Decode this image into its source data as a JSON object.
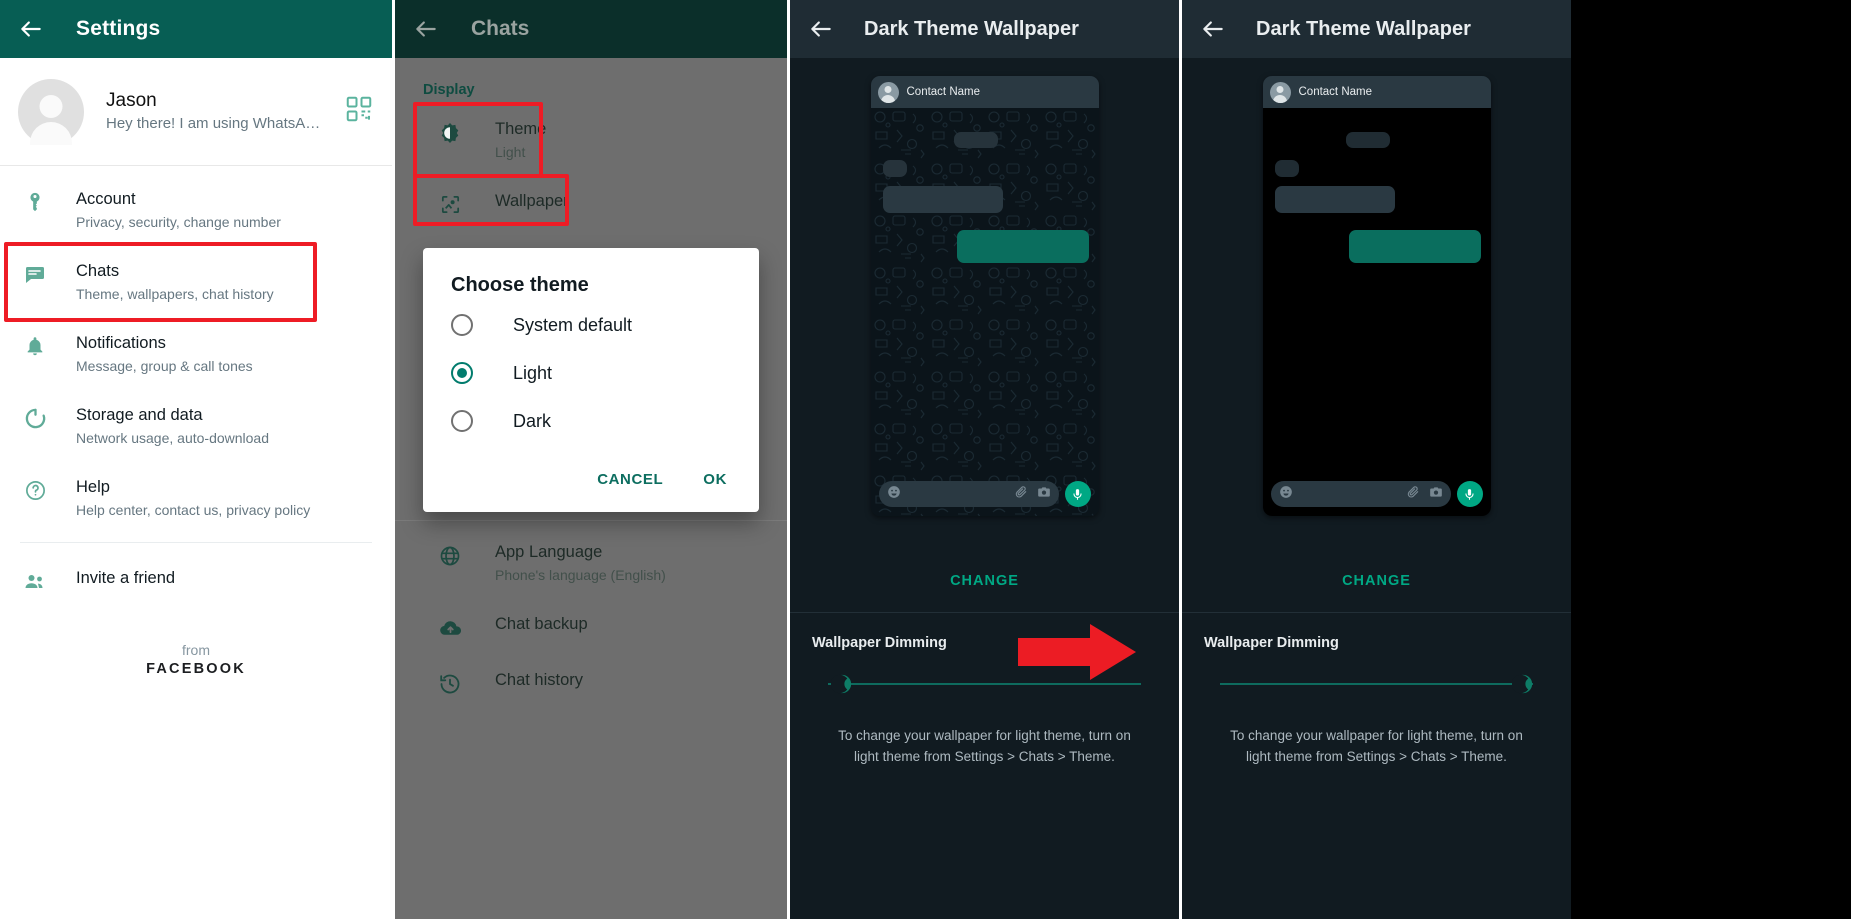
{
  "panel1": {
    "appbar": {
      "title": "Settings",
      "back_icon": "arrow-left-icon"
    },
    "profile": {
      "name": "Jason",
      "status": "Hey there! I am using WhatsA…",
      "qr_icon": "qr-code-icon",
      "avatar_icon": "default-avatar-icon"
    },
    "items": [
      {
        "icon": "key-icon",
        "title": "Account",
        "subtitle": "Privacy, security, change number",
        "highlighted": false
      },
      {
        "icon": "chat-bubble-icon",
        "title": "Chats",
        "subtitle": "Theme, wallpapers, chat history",
        "highlighted": true
      },
      {
        "icon": "bell-icon",
        "title": "Notifications",
        "subtitle": "Message, group & call tones",
        "highlighted": false
      },
      {
        "icon": "data-usage-icon",
        "title": "Storage and data",
        "subtitle": "Network usage, auto-download",
        "highlighted": false
      },
      {
        "icon": "help-circle-icon",
        "title": "Help",
        "subtitle": "Help center, contact us, privacy policy",
        "highlighted": false
      }
    ],
    "invite": {
      "icon": "people-icon",
      "title": "Invite a friend"
    },
    "footer": {
      "from": "from",
      "brand": "FACEBOOK"
    }
  },
  "panel2": {
    "appbar": {
      "title": "Chats",
      "back_icon": "arrow-left-icon"
    },
    "section_label": "Display",
    "items": [
      {
        "icon": "brightness-icon",
        "title": "Theme",
        "subtitle": "Light",
        "highlighted": true
      },
      {
        "icon": "image-icon",
        "title": "Wallpaper",
        "subtitle": "",
        "highlighted": true
      }
    ],
    "items_below": [
      {
        "icon": "globe-icon",
        "title": "App Language",
        "subtitle": "Phone's language (English)"
      },
      {
        "icon": "cloud-upload-icon",
        "title": "Chat backup",
        "subtitle": ""
      },
      {
        "icon": "history-icon",
        "title": "Chat history",
        "subtitle": ""
      }
    ],
    "dialog": {
      "title": "Choose theme",
      "options": [
        {
          "label": "System default",
          "selected": false
        },
        {
          "label": "Light",
          "selected": true
        },
        {
          "label": "Dark",
          "selected": false
        }
      ],
      "cancel_label": "CANCEL",
      "ok_label": "OK"
    }
  },
  "panel3": {
    "appbar": {
      "title": "Dark Theme Wallpaper",
      "back_icon": "arrow-left-icon"
    },
    "preview": {
      "contact_name": "Contact Name",
      "emoji_icon": "emoji-icon",
      "attach_icon": "paperclip-icon",
      "camera_icon": "camera-icon",
      "mic_icon": "microphone-icon"
    },
    "change_label": "CHANGE",
    "dimming": {
      "title": "Wallpaper Dimming",
      "value_percent": 0,
      "thumb_icon": "moon-icon",
      "note": "To change your wallpaper for light theme, turn on light theme from Settings > Chats > Theme."
    }
  },
  "panel4": {
    "appbar": {
      "title": "Dark Theme Wallpaper",
      "back_icon": "arrow-left-icon"
    },
    "preview": {
      "contact_name": "Contact Name",
      "emoji_icon": "emoji-icon",
      "attach_icon": "paperclip-icon",
      "camera_icon": "camera-icon",
      "mic_icon": "microphone-icon"
    },
    "change_label": "CHANGE",
    "dimming": {
      "title": "Wallpaper Dimming",
      "value_percent": 100,
      "thumb_icon": "moon-icon",
      "note": "To change your wallpaper for light theme, turn on light theme from Settings > Chats > Theme."
    }
  },
  "annotations": {
    "arrow_icon": "red-arrow-right",
    "highlight_color": "#ee1c25"
  },
  "colors": {
    "brand_green": "#075e54",
    "accent_teal": "#00a884",
    "dark_bg": "#111b21",
    "dark_appbar": "#1f2c34"
  }
}
